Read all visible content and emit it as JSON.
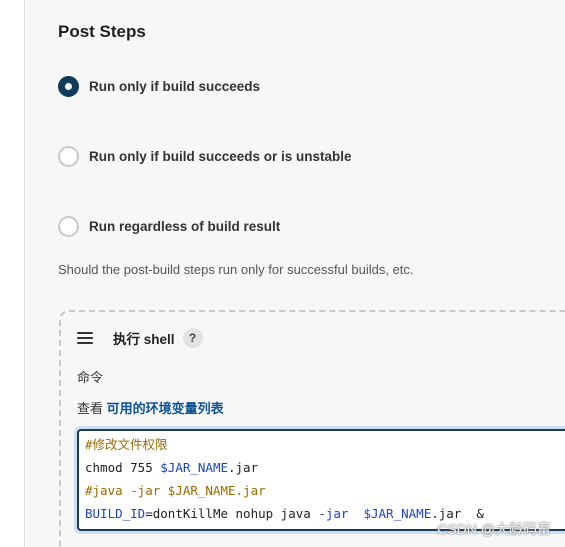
{
  "post_steps": {
    "title": "Post Steps",
    "options": [
      {
        "label": "Run only if build succeeds",
        "checked": true
      },
      {
        "label": "Run only if build succeeds or is unstable",
        "checked": false
      },
      {
        "label": "Run regardless of build result",
        "checked": false
      }
    ],
    "help_text": "Should the post-build steps run only for successful builds, etc."
  },
  "build_step": {
    "title": "执行 shell",
    "help_badge": "?",
    "command_label": "命令",
    "env_prefix": "查看 ",
    "env_link": "可用的环境变量列表",
    "code": {
      "line1": "#修改文件权限",
      "line2_cmd": "chmod 755 ",
      "line2_var": "$JAR_NAME",
      "line2_rest": ".jar",
      "line3": "#java -jar $JAR_NAME.jar",
      "line4_a": "BUILD_ID",
      "line4_b": "=dontKillMe nohup java ",
      "line4_c": "-jar",
      "line4_d": "  ",
      "line4_e": "$JAR_NAME",
      "line4_f": ".jar  &"
    }
  },
  "watermark": "CSDN @大龄码畜"
}
